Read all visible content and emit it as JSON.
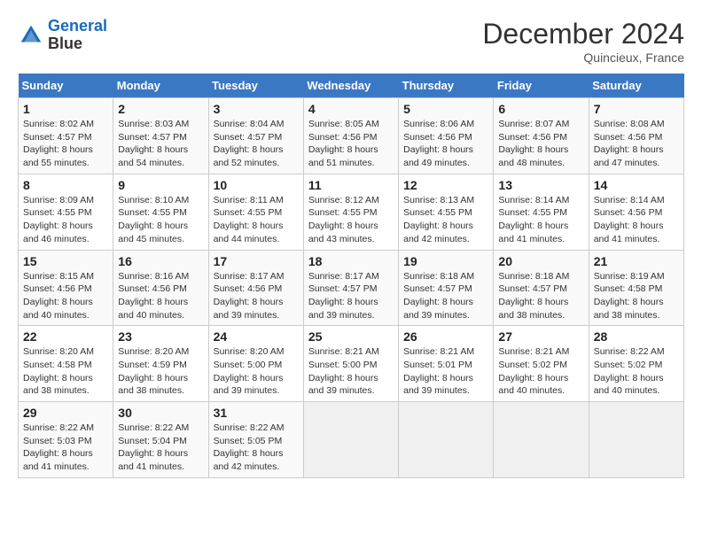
{
  "header": {
    "logo_line1": "General",
    "logo_line2": "Blue",
    "month": "December 2024",
    "location": "Quincieux, France"
  },
  "weekdays": [
    "Sunday",
    "Monday",
    "Tuesday",
    "Wednesday",
    "Thursday",
    "Friday",
    "Saturday"
  ],
  "weeks": [
    [
      {
        "day": "1",
        "rise": "8:02 AM",
        "set": "4:57 PM",
        "daylight": "8 hours and 55 minutes."
      },
      {
        "day": "2",
        "rise": "8:03 AM",
        "set": "4:57 PM",
        "daylight": "8 hours and 54 minutes."
      },
      {
        "day": "3",
        "rise": "8:04 AM",
        "set": "4:57 PM",
        "daylight": "8 hours and 52 minutes."
      },
      {
        "day": "4",
        "rise": "8:05 AM",
        "set": "4:56 PM",
        "daylight": "8 hours and 51 minutes."
      },
      {
        "day": "5",
        "rise": "8:06 AM",
        "set": "4:56 PM",
        "daylight": "8 hours and 49 minutes."
      },
      {
        "day": "6",
        "rise": "8:07 AM",
        "set": "4:56 PM",
        "daylight": "8 hours and 48 minutes."
      },
      {
        "day": "7",
        "rise": "8:08 AM",
        "set": "4:56 PM",
        "daylight": "8 hours and 47 minutes."
      }
    ],
    [
      {
        "day": "8",
        "rise": "8:09 AM",
        "set": "4:55 PM",
        "daylight": "8 hours and 46 minutes."
      },
      {
        "day": "9",
        "rise": "8:10 AM",
        "set": "4:55 PM",
        "daylight": "8 hours and 45 minutes."
      },
      {
        "day": "10",
        "rise": "8:11 AM",
        "set": "4:55 PM",
        "daylight": "8 hours and 44 minutes."
      },
      {
        "day": "11",
        "rise": "8:12 AM",
        "set": "4:55 PM",
        "daylight": "8 hours and 43 minutes."
      },
      {
        "day": "12",
        "rise": "8:13 AM",
        "set": "4:55 PM",
        "daylight": "8 hours and 42 minutes."
      },
      {
        "day": "13",
        "rise": "8:14 AM",
        "set": "4:55 PM",
        "daylight": "8 hours and 41 minutes."
      },
      {
        "day": "14",
        "rise": "8:14 AM",
        "set": "4:56 PM",
        "daylight": "8 hours and 41 minutes."
      }
    ],
    [
      {
        "day": "15",
        "rise": "8:15 AM",
        "set": "4:56 PM",
        "daylight": "8 hours and 40 minutes."
      },
      {
        "day": "16",
        "rise": "8:16 AM",
        "set": "4:56 PM",
        "daylight": "8 hours and 40 minutes."
      },
      {
        "day": "17",
        "rise": "8:17 AM",
        "set": "4:56 PM",
        "daylight": "8 hours and 39 minutes."
      },
      {
        "day": "18",
        "rise": "8:17 AM",
        "set": "4:57 PM",
        "daylight": "8 hours and 39 minutes."
      },
      {
        "day": "19",
        "rise": "8:18 AM",
        "set": "4:57 PM",
        "daylight": "8 hours and 39 minutes."
      },
      {
        "day": "20",
        "rise": "8:18 AM",
        "set": "4:57 PM",
        "daylight": "8 hours and 38 minutes."
      },
      {
        "day": "21",
        "rise": "8:19 AM",
        "set": "4:58 PM",
        "daylight": "8 hours and 38 minutes."
      }
    ],
    [
      {
        "day": "22",
        "rise": "8:20 AM",
        "set": "4:58 PM",
        "daylight": "8 hours and 38 minutes."
      },
      {
        "day": "23",
        "rise": "8:20 AM",
        "set": "4:59 PM",
        "daylight": "8 hours and 38 minutes."
      },
      {
        "day": "24",
        "rise": "8:20 AM",
        "set": "5:00 PM",
        "daylight": "8 hours and 39 minutes."
      },
      {
        "day": "25",
        "rise": "8:21 AM",
        "set": "5:00 PM",
        "daylight": "8 hours and 39 minutes."
      },
      {
        "day": "26",
        "rise": "8:21 AM",
        "set": "5:01 PM",
        "daylight": "8 hours and 39 minutes."
      },
      {
        "day": "27",
        "rise": "8:21 AM",
        "set": "5:02 PM",
        "daylight": "8 hours and 40 minutes."
      },
      {
        "day": "28",
        "rise": "8:22 AM",
        "set": "5:02 PM",
        "daylight": "8 hours and 40 minutes."
      }
    ],
    [
      {
        "day": "29",
        "rise": "8:22 AM",
        "set": "5:03 PM",
        "daylight": "8 hours and 41 minutes."
      },
      {
        "day": "30",
        "rise": "8:22 AM",
        "set": "5:04 PM",
        "daylight": "8 hours and 41 minutes."
      },
      {
        "day": "31",
        "rise": "8:22 AM",
        "set": "5:05 PM",
        "daylight": "8 hours and 42 minutes."
      },
      null,
      null,
      null,
      null
    ]
  ]
}
